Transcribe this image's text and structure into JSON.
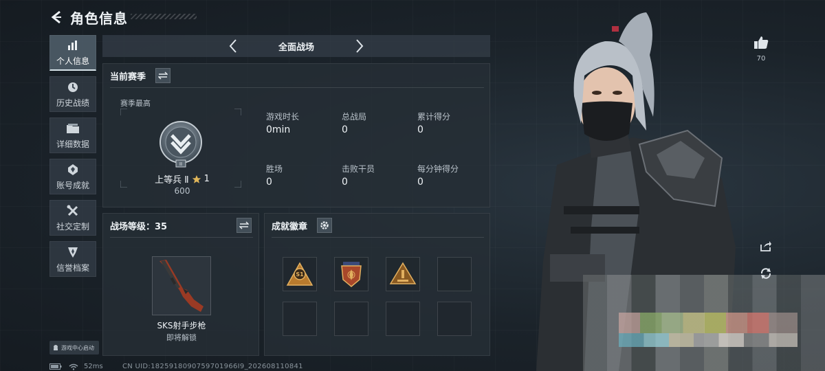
{
  "header": {
    "title": "角色信息"
  },
  "nav": {
    "items": [
      {
        "label": "个人信息",
        "icon": "bar-chart-icon"
      },
      {
        "label": "历史战绩",
        "icon": "clock-icon"
      },
      {
        "label": "详细数据",
        "icon": "folder-icon"
      },
      {
        "label": "账号成就",
        "icon": "medal-icon"
      },
      {
        "label": "社交定制",
        "icon": "tools-icon"
      },
      {
        "label": "信誉档案",
        "icon": "shield-icon"
      }
    ],
    "active_index": 0
  },
  "launch_badge": {
    "label": "游戏中心启动"
  },
  "status": {
    "ping": "52ms",
    "uid": "CN UID:1825918090759701966I9_202608110841"
  },
  "mode": {
    "title": "全面战场"
  },
  "season": {
    "title": "当前赛季",
    "best_label": "赛季最高",
    "rank_name": "上等兵 Ⅱ",
    "stars": "1",
    "score": "600",
    "stats": [
      {
        "label": "游戏时长",
        "value": "0min"
      },
      {
        "label": "总战局",
        "value": "0"
      },
      {
        "label": "累计得分",
        "value": "0"
      },
      {
        "label": "胜场",
        "value": "0"
      },
      {
        "label": "击败干员",
        "value": "0"
      },
      {
        "label": "每分钟得分",
        "value": "0"
      }
    ]
  },
  "battlefield": {
    "title": "战场等级：35",
    "weapon_name": "SKS射手步枪",
    "weapon_status": "即将解锁"
  },
  "achievements": {
    "title": "成就徽章",
    "badges": [
      "s1-badge",
      "shield-star-badge",
      "triangle-badge",
      "empty",
      "empty",
      "empty",
      "empty",
      "empty"
    ]
  },
  "likes": {
    "count": "70"
  },
  "colors": {
    "accent": "#d8e4ea",
    "panel": "#262e36",
    "badge_gold": "#c7913a",
    "weapon_red": "#9a3a24"
  }
}
